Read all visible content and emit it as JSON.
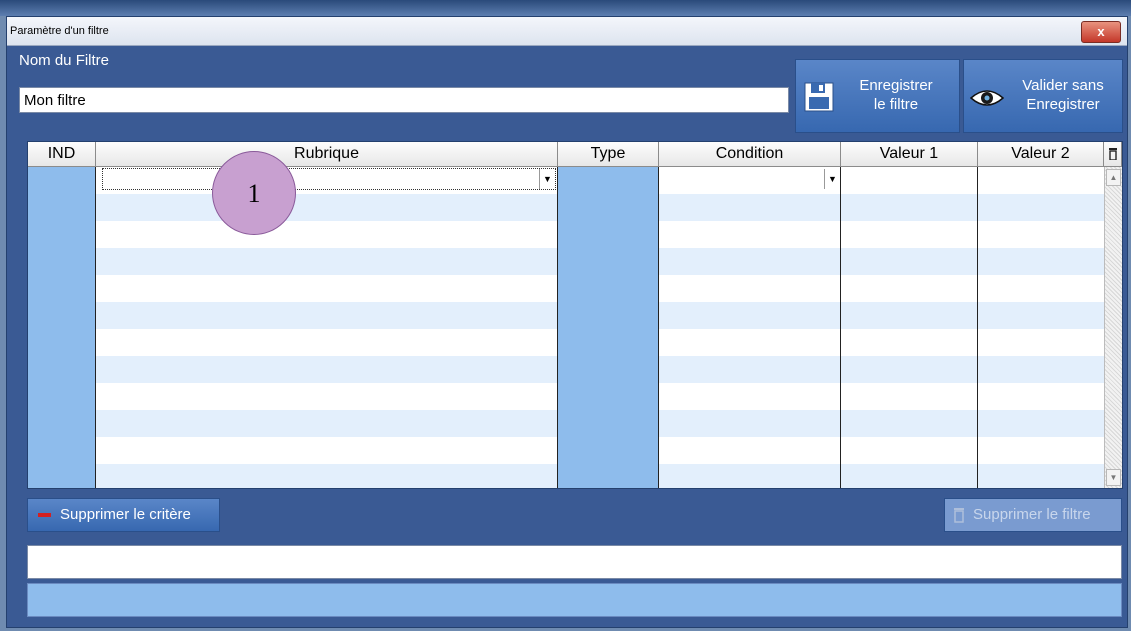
{
  "window": {
    "title": "Paramètre d'un filtre",
    "close_glyph": "x"
  },
  "filter_name": {
    "label": "Nom du Filtre",
    "value": "Mon filtre"
  },
  "buttons": {
    "save_line1": "Enregistrer",
    "save_line2": "le filtre",
    "validate_line1": "Valider sans",
    "validate_line2": "Enregistrer",
    "delete_criterion": "Supprimer le critère",
    "delete_filter": "Supprimer le filtre"
  },
  "grid": {
    "columns": [
      "IND",
      "Rubrique",
      "Type",
      "Condition",
      "Valeur 1",
      "Valeur 2"
    ],
    "row_count": 12
  },
  "annotation": {
    "badge": "1"
  },
  "icons": {
    "save": "floppy-disk-icon",
    "validate": "eye-icon",
    "delete_criterion": "minus-icon",
    "delete_filter": "trash-icon",
    "column_picker": "trash-icon"
  },
  "colors": {
    "window_bg": "#3a5a94",
    "button_blue": "#4a7bc0",
    "column_fill": "#8ebcec",
    "row_alt": "#e3effc",
    "minus_red": "#d42020",
    "badge": "#c8a0d0"
  }
}
